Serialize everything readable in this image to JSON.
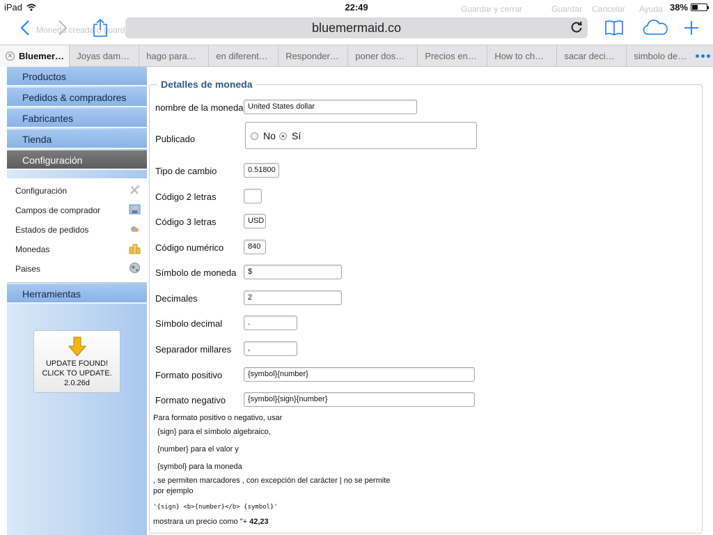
{
  "status": {
    "device": "iPad",
    "time": "22:49",
    "battery": "38%",
    "battery_level": 0.38
  },
  "toolbar": {
    "url": "bluemermaid.co",
    "ghost_left": "Moneda  creada o guardado",
    "ghost_right": [
      "Guardar y cerrar",
      "Guardar",
      "Cancelar",
      "Ayuda"
    ]
  },
  "tabs": [
    "Bluemer…",
    "Joyas dam…",
    "hago para…",
    "en diferent…",
    "Responder…",
    "poner dos…",
    "Precios en…",
    "How to ch…",
    "sacar deci…",
    "simbolo de…"
  ],
  "sidebar": {
    "menu": [
      "Productos",
      "Pedidos & compradores",
      "Fabricantes",
      "Tienda",
      "Configuración"
    ],
    "submenu": [
      "Configuración",
      "Campos de comprador",
      "Estados de pedidos",
      "Monedas",
      "Paises"
    ],
    "tools": "Herramientas",
    "update": {
      "line1": "UPDATE FOUND!",
      "line2": "CLICK TO UPDATE.",
      "version": "2.0.26d"
    }
  },
  "form": {
    "legend": "Detalles de moneda",
    "name_label": "nombre de la moneda",
    "name_value": "United States dollar",
    "published_label": "Publicado",
    "published_no": "No",
    "published_yes": "Sí",
    "rate_label": "Tipo de cambio",
    "rate_value": "0.51800",
    "code2_label": "Código 2 letras",
    "code2_value": "",
    "code3_label": "Código 3 letras",
    "code3_value": "USD",
    "numeric_label": "Código numérico",
    "numeric_value": "840",
    "symbol_label": "Símbolo de moneda",
    "symbol_value": "$",
    "decimals_label": "Decimales",
    "decimals_value": "2",
    "decsym_label": "Símbolo decimal",
    "decsym_value": ".",
    "thousands_label": "Separador millares",
    "thousands_value": ",",
    "positive_label": "Formato positivo",
    "positive_value": "{symbol}{number}",
    "negative_label": "Formato negativo",
    "negative_value": "{symbol}{sign}{number}"
  },
  "help": {
    "line1": "Para formato positivo o negativo, usar",
    "line2": "{sign} para el símbolo algebraico,",
    "line3": "{number} para el valor y",
    "line4": "{symbol} para la moneda",
    "line5": ", se permiten marcadores , con excepción del carácter | no se permite",
    "line6": "por ejemplo",
    "example": "'{sign} <b>{number}</b> {symbol}'",
    "result_prefix": "mostrara un precio como \"+ ",
    "result_value": "42,23"
  }
}
